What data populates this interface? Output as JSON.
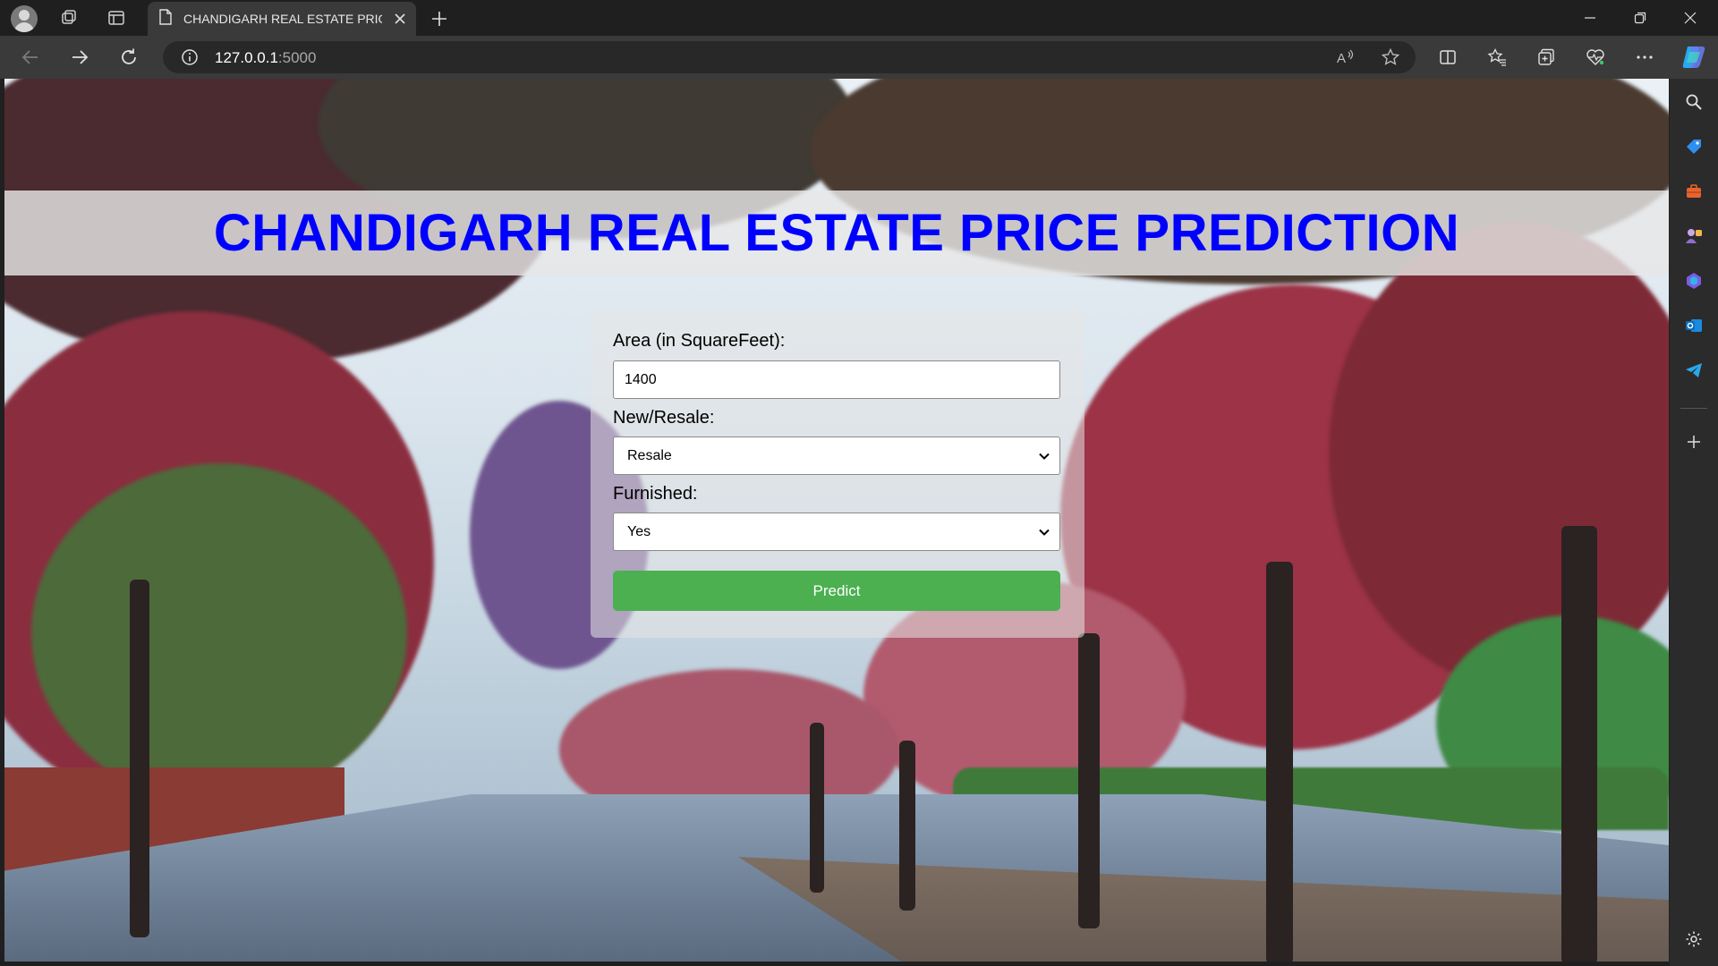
{
  "browser": {
    "tab_title": "CHANDIGARH REAL ESTATE PRIC",
    "url_host": "127.0.0.1",
    "url_port": ":5000",
    "icons": {
      "profile": "avatar-icon",
      "workspaces": "workspaces-icon",
      "tab_actions": "tab-actions-icon",
      "tab_favicon": "page-icon",
      "tab_close": "close-icon",
      "new_tab": "plus-icon",
      "back": "back-arrow-icon",
      "forward": "forward-arrow-icon",
      "refresh": "refresh-icon",
      "site_info": "info-icon",
      "read_aloud": "read-aloud-icon",
      "favorite": "star-icon",
      "split_screen": "split-screen-icon",
      "favorites": "favorites-icon",
      "collections": "collections-icon",
      "performance": "heart-pulse-icon",
      "more": "more-icon",
      "copilot": "copilot-icon"
    }
  },
  "sidebar": {
    "icons": [
      "search-icon",
      "shopping-tag-icon",
      "tools-icon",
      "games-icon",
      "microsoft365-icon",
      "outlook-icon",
      "telegram-icon",
      "add-icon",
      "settings-icon"
    ]
  },
  "page": {
    "title": "CHANDIGARH REAL ESTATE PRICE PREDICTION",
    "form": {
      "area_label": "Area (in SquareFeet):",
      "area_value": "1400",
      "new_resale_label": "New/Resale:",
      "new_resale_value": "Resale",
      "furnished_label": "Furnished:",
      "furnished_value": "Yes",
      "predict_label": "Predict"
    }
  },
  "colors": {
    "title": "#0000ff",
    "predict_button": "#4caf50"
  }
}
